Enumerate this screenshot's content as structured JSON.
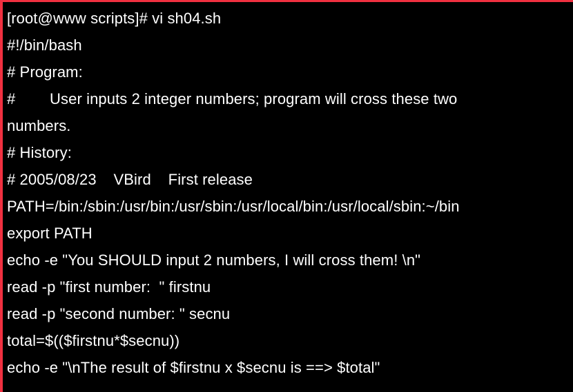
{
  "window": {
    "title": "[root@www scripts]# vi sh04.sh",
    "background_color": "#000000",
    "foreground_color": "#ffffff",
    "border_color": "#f03040",
    "border_top_px": "3",
    "border_left_px": "4"
  },
  "terminal": {
    "prompt": "[root@www scripts]#",
    "command": "vi sh04.sh",
    "rows": 13,
    "columns": 42,
    "lines": [
      "[root@www scripts]# vi sh04.sh",
      "#!/bin/bash",
      "# Program:",
      "#        User inputs 2 integer numbers; program will cross these two",
      "numbers.",
      "# History:",
      "# 2005/08/23    VBird    First release",
      "PATH=/bin:/sbin:/usr/bin:/usr/sbin:/usr/local/bin:/usr/local/sbin:~/bin",
      "export PATH",
      "echo -e \"You SHOULD input 2 numbers, I will cross them! \\n\"",
      "read -p \"first number:  \" firstnu",
      "read -p \"second number: \" secnu",
      "total=$(($firstnu*$secnu))",
      "echo -e \"\\nThe result of $firstnu x $secnu is ==> $total\""
    ],
    "display_rows": [
      {
        "text": "[root@www scripts]# vi sh04.sh",
        "wrapped": false
      },
      {
        "text": "#!/bin/bash",
        "wrapped": false
      },
      {
        "text": "# Program:",
        "wrapped": false
      },
      {
        "text": "#        User inputs 2 integer numbers; program will cross these two",
        "wrapped": false
      },
      {
        "text": "numbers.",
        "wrapped": true
      },
      {
        "text": "# History:",
        "wrapped": false
      },
      {
        "text": "# 2005/08/23    VBird    First release",
        "wrapped": false
      },
      {
        "text": "PATH=/bin:/sbin:/usr/bin:/usr/sbin:/usr/local/bin:/usr/local/sbin:~/bin",
        "wrapped": false
      },
      {
        "text": "export PATH",
        "wrapped": false
      },
      {
        "text": "echo -e \"You SHOULD input 2 numbers, I will cross them! \\n\"",
        "wrapped": false
      },
      {
        "text": "read -p \"first number:  \" firstnu",
        "wrapped": false
      },
      {
        "text": "read -p \"second number: \" secnu",
        "wrapped": false
      },
      {
        "text": "total=$(($firstnu*$secnu))",
        "wrapped": false
      },
      {
        "text": "echo -e \"\\nThe result of $firstnu x $secnu is ==> $total\"",
        "wrapped": false
      }
    ]
  }
}
